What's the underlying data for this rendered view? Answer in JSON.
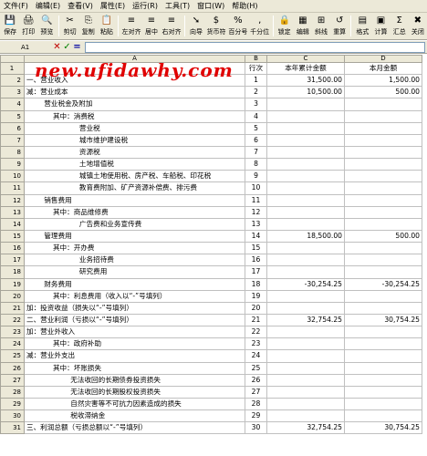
{
  "menu": [
    {
      "label": "文件(F)"
    },
    {
      "label": "编辑(E)"
    },
    {
      "label": "查看(V)"
    },
    {
      "label": "属性(E)"
    },
    {
      "label": "运行(R)"
    },
    {
      "label": "工具(T)"
    },
    {
      "label": "窗口(W)"
    },
    {
      "label": "帮助(H)"
    }
  ],
  "toolbar": [
    {
      "icon": "💾",
      "label": "保存"
    },
    {
      "icon": "🖨",
      "label": "打印"
    },
    {
      "icon": "🔍",
      "label": "预览"
    },
    {
      "icon": "✂",
      "label": "剪切"
    },
    {
      "icon": "⎘",
      "label": "复制"
    },
    {
      "icon": "📋",
      "label": "粘贴"
    },
    {
      "icon": "≡",
      "label": "左对齐"
    },
    {
      "icon": "≡",
      "label": "居中"
    },
    {
      "icon": "≡",
      "label": "右对齐"
    },
    {
      "icon": "➘",
      "label": "向导"
    },
    {
      "icon": "$",
      "label": "货币符"
    },
    {
      "icon": "%",
      "label": "百分号"
    },
    {
      "icon": ",",
      "label": "千分位"
    },
    {
      "icon": "🔒",
      "label": "锁定"
    },
    {
      "icon": "▦",
      "label": "编辑"
    },
    {
      "icon": "⊞",
      "label": "斜线"
    },
    {
      "icon": "↺",
      "label": "重算"
    },
    {
      "icon": "▤",
      "label": "格式"
    },
    {
      "icon": "▣",
      "label": "计算"
    },
    {
      "icon": "Σ",
      "label": "汇总"
    },
    {
      "icon": "✖",
      "label": "关闭"
    }
  ],
  "formula_bar": {
    "cell_ref": "A1",
    "cancel": "✕",
    "confirm": "✓",
    "equals": "="
  },
  "watermark": "new.ufidawhy.com",
  "columns": [
    "A",
    "B",
    "C",
    "D"
  ],
  "header_row": {
    "row": "1",
    "col_b": "行次",
    "col_c": "本年累计金额",
    "col_d": "本月金额"
  },
  "rows": [
    {
      "row": "2",
      "a": "一、营业收入",
      "b": "1",
      "c": "31,500.00",
      "d": "1,500.00"
    },
    {
      "row": "3",
      "a": "减：营业成本",
      "b": "2",
      "c": "10,500.00",
      "d": "500.00"
    },
    {
      "row": "4",
      "a": "        营业税金及附加",
      "b": "3",
      "c": "",
      "d": ""
    },
    {
      "row": "5",
      "a": "            其中：消费税",
      "b": "4",
      "c": "",
      "d": ""
    },
    {
      "row": "6",
      "a": "                        营业税",
      "b": "5",
      "c": "",
      "d": ""
    },
    {
      "row": "7",
      "a": "                        城市维护建设税",
      "b": "6",
      "c": "",
      "d": ""
    },
    {
      "row": "8",
      "a": "                        资源税",
      "b": "7",
      "c": "",
      "d": ""
    },
    {
      "row": "9",
      "a": "                        土地增值税",
      "b": "8",
      "c": "",
      "d": ""
    },
    {
      "row": "10",
      "a": "                        城镇土地使用税、房产税、车船税、印花税",
      "b": "9",
      "c": "",
      "d": ""
    },
    {
      "row": "11",
      "a": "                        教育费附加、矿产资源补偿费、排污费",
      "b": "10",
      "c": "",
      "d": ""
    },
    {
      "row": "12",
      "a": "        销售费用",
      "b": "11",
      "c": "",
      "d": ""
    },
    {
      "row": "13",
      "a": "            其中：商品维修费",
      "b": "12",
      "c": "",
      "d": ""
    },
    {
      "row": "14",
      "a": "                        广告费和业务宣传费",
      "b": "13",
      "c": "",
      "d": ""
    },
    {
      "row": "15",
      "a": "        管理费用",
      "b": "14",
      "c": "18,500.00",
      "d": "500.00"
    },
    {
      "row": "16",
      "a": "            其中：开办费",
      "b": "15",
      "c": "",
      "d": ""
    },
    {
      "row": "17",
      "a": "                        业务招待费",
      "b": "16",
      "c": "",
      "d": ""
    },
    {
      "row": "18",
      "a": "                        研究费用",
      "b": "17",
      "c": "",
      "d": ""
    },
    {
      "row": "19",
      "a": "        财务费用",
      "b": "18",
      "c": "-30,254.25",
      "d": "-30,254.25"
    },
    {
      "row": "20",
      "a": "            其中：利息费用（收入以“-”号填列）",
      "b": "19",
      "c": "",
      "d": ""
    },
    {
      "row": "21",
      "a": "加：投资收益（损失以“-”号填列）",
      "b": "20",
      "c": "",
      "d": ""
    },
    {
      "row": "22",
      "a": "二、营业利润（亏损以“-”号填列）",
      "b": "21",
      "c": "32,754.25",
      "d": "30,754.25"
    },
    {
      "row": "23",
      "a": "加：营业外收入",
      "b": "22",
      "c": "",
      "d": ""
    },
    {
      "row": "24",
      "a": "            其中：政府补助",
      "b": "23",
      "c": "",
      "d": ""
    },
    {
      "row": "25",
      "a": "减：营业外支出",
      "b": "24",
      "c": "",
      "d": ""
    },
    {
      "row": "26",
      "a": "            其中：坏账损失",
      "b": "25",
      "c": "",
      "d": ""
    },
    {
      "row": "27",
      "a": "                    无法收回的长期债券投资损失",
      "b": "26",
      "c": "",
      "d": ""
    },
    {
      "row": "28",
      "a": "                    无法收回的长期股权投资损失",
      "b": "27",
      "c": "",
      "d": ""
    },
    {
      "row": "29",
      "a": "                    自然灾害等不可抗力因素造成的损失",
      "b": "28",
      "c": "",
      "d": ""
    },
    {
      "row": "30",
      "a": "                    税收滞纳金",
      "b": "29",
      "c": "",
      "d": ""
    },
    {
      "row": "31",
      "a": "三、利润总额（亏损总额以“-”号填列）",
      "b": "30",
      "c": "32,754.25",
      "d": "30,754.25"
    }
  ]
}
